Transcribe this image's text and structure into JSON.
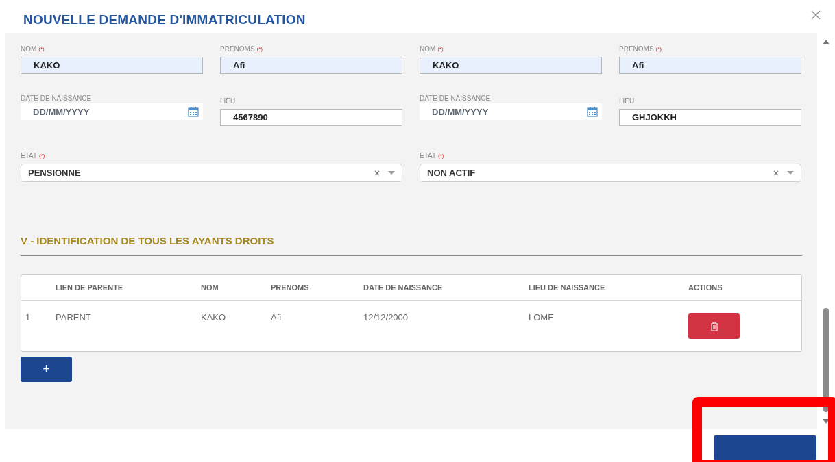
{
  "dialog": {
    "title": "NOUVELLE DEMANDE D'IMMATRICULATION"
  },
  "parents": [
    {
      "nom": {
        "label": "NOM",
        "required_mark": "(*)",
        "value": "KAKO"
      },
      "prenoms": {
        "label": "PRENOMS",
        "required_mark": "(*)",
        "value": "Afi"
      },
      "date": {
        "label": "DATE DE NAISSANCE",
        "placeholder": "DD/MM/YYYY"
      },
      "lieu": {
        "label": "LIEU",
        "value": "4567890"
      },
      "etat": {
        "label": "ETAT",
        "required_mark": "(*)",
        "value": "PENSIONNE"
      }
    },
    {
      "nom": {
        "label": "NOM",
        "required_mark": "(*)",
        "value": "KAKO"
      },
      "prenoms": {
        "label": "PRENOMS",
        "required_mark": "(*)",
        "value": "Afi"
      },
      "date": {
        "label": "DATE DE NAISSANCE",
        "placeholder": "DD/MM/YYYY"
      },
      "lieu": {
        "label": "LIEU",
        "value": "GHJOKKH"
      },
      "etat": {
        "label": "ETAT",
        "required_mark": "(*)",
        "value": "NON ACTIF"
      }
    }
  ],
  "section_title": "V - IDENTIFICATION DE TOUS LES AYANTS DROITS",
  "table": {
    "columns": [
      "",
      "LIEN DE PARENTE",
      "NOM",
      "PRENOMS",
      "DATE DE NAISSANCE",
      "LIEU DE NAISSANCE",
      "ACTIONS"
    ],
    "rows": [
      {
        "cells": [
          "1",
          "PARENT",
          "KAKO",
          "Afi",
          "12/12/2000",
          "LOME"
        ]
      }
    ]
  },
  "add_button": {
    "label": "+"
  }
}
